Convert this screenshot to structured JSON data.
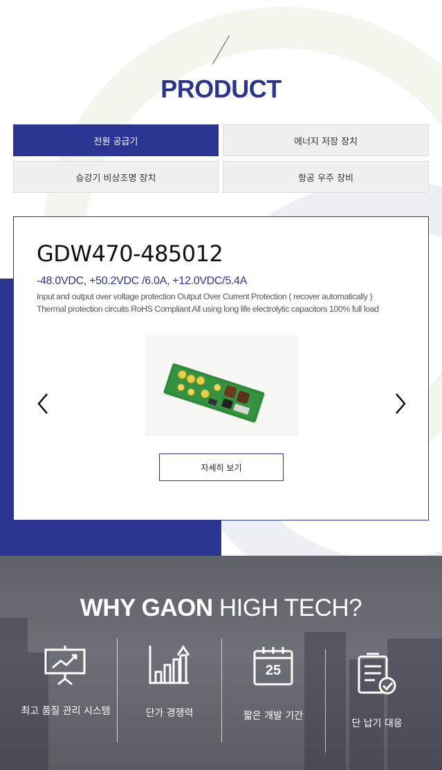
{
  "product": {
    "title": "PRODUCT",
    "tabs": [
      {
        "label": "전원 공급기",
        "active": true
      },
      {
        "label": "에너지 저장 장치",
        "active": false
      },
      {
        "label": "승강기 비상조명 장치",
        "active": false
      },
      {
        "label": "항공 우주 장비",
        "active": false
      }
    ],
    "card": {
      "model": "GDW470-485012",
      "spec": "-48.0VDC, +50.2VDC /6.0A, +12.0VDC/5.4A",
      "desc_line1": "Input and output over voltage protection Output Over Current Protection ( recover automatically )",
      "desc_line2": "Thermal protection circuits RoHS Compliant All using long life electrolytic capacitors 100% full load",
      "detail_button": "자세히 보기"
    }
  },
  "why": {
    "title_bold": "WHY GAON",
    "title_light": " HIGH TECH?",
    "features": [
      {
        "label": "최고 품질 관리 시스템",
        "icon": "presentation-chart-icon"
      },
      {
        "label": "단가 경쟁력",
        "icon": "bar-chart-icon"
      },
      {
        "label": "짧은 개발 기간",
        "icon": "calendar-icon",
        "calendar_day": "25"
      },
      {
        "label": "단 납기 대응",
        "icon": "checklist-icon"
      }
    ]
  },
  "colors": {
    "brand": "#2a3591",
    "tab_inactive": "#f0f0f0",
    "pcb_green": "#2e8b3a"
  }
}
